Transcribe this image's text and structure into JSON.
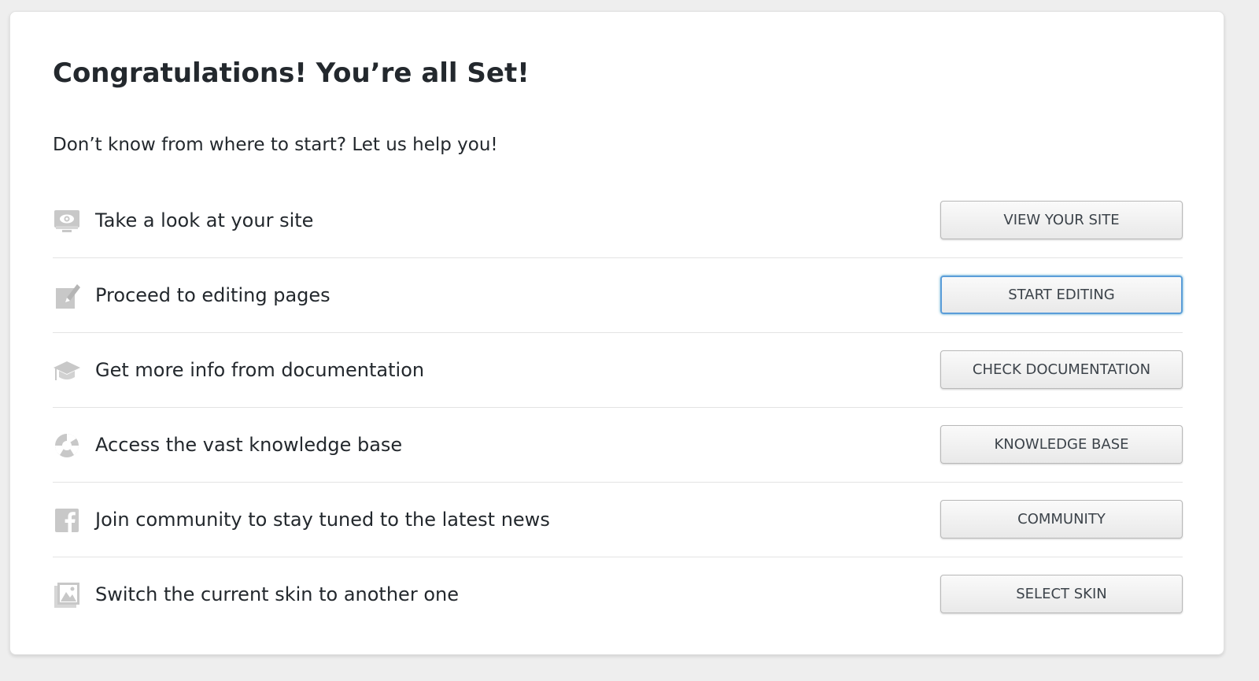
{
  "title": "Congratulations! You’re all Set!",
  "subtitle": "Don’t know from where to start? Let us help you!",
  "colors": {
    "icon": "#c8c8c8",
    "text": "#23282d",
    "focus_ring": "#5b9dd9"
  },
  "rows": [
    {
      "icon": "monitor-eye-icon",
      "label": "Take a look at your site",
      "button": "VIEW YOUR SITE"
    },
    {
      "icon": "edit-icon",
      "label": "Proceed to editing pages",
      "button": "START EDITING",
      "focused": true
    },
    {
      "icon": "graduation-cap-icon",
      "label": "Get more info from documentation",
      "button": "CHECK DOCUMENTATION"
    },
    {
      "icon": "lifebuoy-icon",
      "label": "Access the vast knowledge base",
      "button": "KNOWLEDGE BASE"
    },
    {
      "icon": "facebook-icon",
      "label": "Join community to stay tuned to the latest news",
      "button": "COMMUNITY"
    },
    {
      "icon": "image-icon",
      "label": "Switch the current skin to another one",
      "button": "SELECT SKIN"
    }
  ]
}
